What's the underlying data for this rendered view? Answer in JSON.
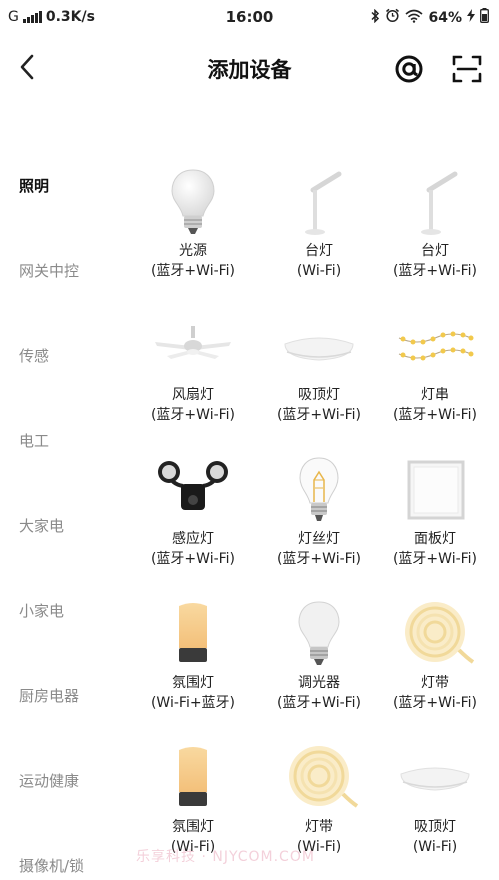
{
  "status_bar": {
    "network": "G",
    "speed": "0.3K/s",
    "time": "16:00",
    "battery": "64%"
  },
  "header": {
    "title": "添加设备"
  },
  "sidebar": {
    "items": [
      {
        "label": "照明",
        "active": true
      },
      {
        "label": "网关中控"
      },
      {
        "label": "传感"
      },
      {
        "label": "电工"
      },
      {
        "label": "大家电"
      },
      {
        "label": "小家电"
      },
      {
        "label": "厨房电器"
      },
      {
        "label": "运动健康"
      },
      {
        "label": "摄像机/锁"
      }
    ]
  },
  "devices": [
    {
      "name": "光源",
      "conn": "(蓝牙+Wi-Fi)",
      "icon": "bulb-icon"
    },
    {
      "name": "台灯",
      "conn": "(Wi-Fi)",
      "icon": "desk-lamp-icon"
    },
    {
      "name": "台灯",
      "conn": "(蓝牙+Wi-Fi)",
      "icon": "desk-lamp-icon"
    },
    {
      "name": "风扇灯",
      "conn": "(蓝牙+Wi-Fi)",
      "icon": "fan-light-icon"
    },
    {
      "name": "吸顶灯",
      "conn": "(蓝牙+Wi-Fi)",
      "icon": "ceiling-light-icon"
    },
    {
      "name": "灯串",
      "conn": "(蓝牙+Wi-Fi)",
      "icon": "string-lights-icon"
    },
    {
      "name": "感应灯",
      "conn": "(蓝牙+Wi-Fi)",
      "icon": "sensor-light-icon"
    },
    {
      "name": "灯丝灯",
      "conn": "(蓝牙+Wi-Fi)",
      "icon": "filament-bulb-icon"
    },
    {
      "name": "面板灯",
      "conn": "(蓝牙+Wi-Fi)",
      "icon": "panel-light-icon"
    },
    {
      "name": "氛围灯",
      "conn": "(Wi-Fi+蓝牙)",
      "icon": "ambient-light-icon"
    },
    {
      "name": "调光器",
      "conn": "(蓝牙+Wi-Fi)",
      "icon": "dimmer-bulb-icon"
    },
    {
      "name": "灯带",
      "conn": "(蓝牙+Wi-Fi)",
      "icon": "light-strip-icon"
    },
    {
      "name": "氛围灯",
      "conn": "(Wi-Fi)",
      "icon": "ambient-light-icon"
    },
    {
      "name": "灯带",
      "conn": "(Wi-Fi)",
      "icon": "light-strip-icon"
    },
    {
      "name": "吸顶灯",
      "conn": "(Wi-Fi)",
      "icon": "ceiling-light-icon"
    }
  ],
  "watermark": "乐享科技 · NJYCOM.COM",
  "colors": {
    "active_text": "#111111",
    "inactive_text": "#8a8a8a",
    "warm_glow": "#f7e6b8"
  }
}
